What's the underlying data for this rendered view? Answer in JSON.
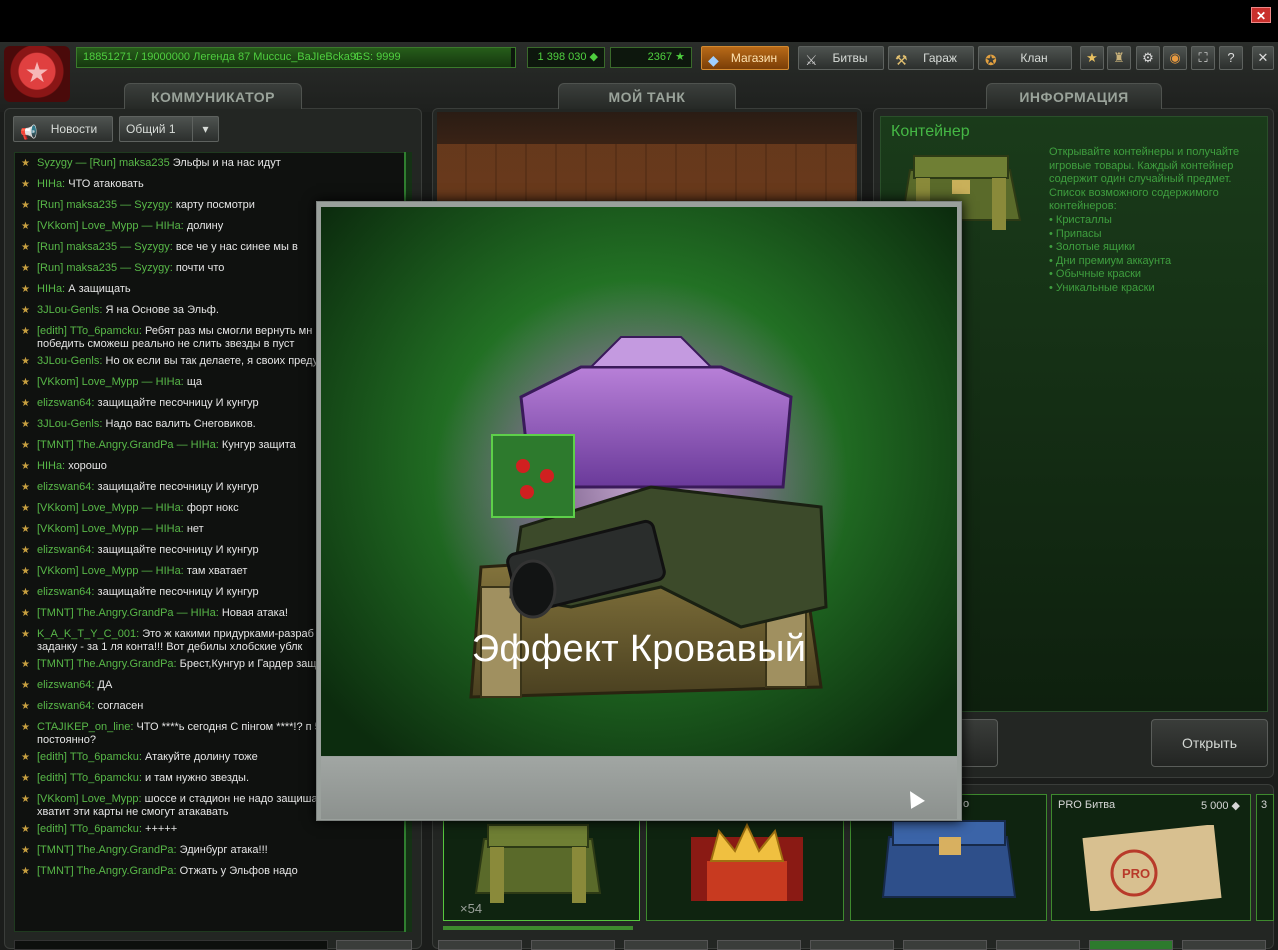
{
  "topbar": {
    "rank_text": "18851271 / 19000000  Легенда 87 Muccuc_BaJIeBcka9I",
    "rank_progress": 0.99,
    "gs": "GS: 9999",
    "crystals": "1 398 030",
    "stars": "2367",
    "shop": "Магазин",
    "battles": "Битвы",
    "garage": "Гараж",
    "clan": "Клан",
    "help": "?"
  },
  "panels": {
    "communicator": "КОММУНИКАТОР",
    "my_tank": "МОЙ ТАНК",
    "information": "ИНФОРМАЦИЯ"
  },
  "chat": {
    "news_button": "Новости",
    "channel": "Общий 1",
    "messages": [
      {
        "sender": "Syzygy",
        "receiver": "[Run] maksa235",
        "text": "Эльфы и на нас идут"
      },
      {
        "sender": "HIHa:",
        "receiver": "",
        "text": "ЧТО атаковать"
      },
      {
        "sender": "[Run] maksa235",
        "receiver": "Syzygy:",
        "text": "карту посмотри"
      },
      {
        "sender": "[VKkom] Love_Mypp",
        "receiver": "HIHa:",
        "text": "долину"
      },
      {
        "sender": "[Run] maksa235",
        "receiver": "Syzygy:",
        "text": "все че у нас синее мы в"
      },
      {
        "sender": "[Run] maksa235",
        "receiver": "Syzygy:",
        "text": "почти что"
      },
      {
        "sender": "HIHa:",
        "receiver": "",
        "text": "А защищать"
      },
      {
        "sender": "3JLou-Genls:",
        "receiver": "",
        "text": "Я на Основе за Эльф."
      },
      {
        "sender": "[edith] TTo_6pamcku:",
        "receiver": "",
        "text": "Ребят раз мы смогли вернуть мн карт,значит и победить сможеш реально не слить звезды в пуст"
      },
      {
        "sender": "3JLou-Genls:",
        "receiver": "",
        "text": "Но ок если вы так делаете, я своих преду"
      },
      {
        "sender": "[VKkom] Love_Mypp",
        "receiver": "HIHa:",
        "text": "ща"
      },
      {
        "sender": "elizswan64:",
        "receiver": "",
        "text": "защищайте песочницу И кунгур"
      },
      {
        "sender": "3JLou-Genls:",
        "receiver": "",
        "text": "Надо вас валить Снеговиков."
      },
      {
        "sender": "[TMNT] The.Angry.GrandPa",
        "receiver": "HIHa:",
        "text": "Кунгур защита"
      },
      {
        "sender": "HIHa:",
        "receiver": "",
        "text": "хорошо"
      },
      {
        "sender": "elizswan64:",
        "receiver": "",
        "text": "защищайте песочницу И кунгур"
      },
      {
        "sender": "[VKkom] Love_Mypp",
        "receiver": "HIHa:",
        "text": "форт нокс"
      },
      {
        "sender": "[VKkom] Love_Mypp",
        "receiver": "HIHa:",
        "text": "нет"
      },
      {
        "sender": "elizswan64:",
        "receiver": "",
        "text": "защищайте песочницу И кунгур"
      },
      {
        "sender": "[VKkom] Love_Mypp",
        "receiver": "HIHa:",
        "text": "там хватает"
      },
      {
        "sender": "elizswan64:",
        "receiver": "",
        "text": "защищайте песочницу И кунгур"
      },
      {
        "sender": "[TMNT] The.Angry.GrandPa",
        "receiver": "HIHa:",
        "text": "Новая атака!"
      },
      {
        "sender": "K_A_K_T_Y_C_001:",
        "receiver": "",
        "text": "Это ж какими придурками-разраб что бы сотворить заданку - за 1 ля конта!!! Вот дебилы хлобские ублк"
      },
      {
        "sender": "[TMNT] The.Angry.GrandPa:",
        "receiver": "",
        "text": "Брест,Кунгур и Гардер защ"
      },
      {
        "sender": "elizswan64:",
        "receiver": "",
        "text": "ДА"
      },
      {
        "sender": "elizswan64:",
        "receiver": "",
        "text": "согласен"
      },
      {
        "sender": "CTAJIKEP_on_line:",
        "receiver": "",
        "text": "ЧТО ****ь сегодня С пінгом ****!? п 500 І ВЫШЕ постоянно?"
      },
      {
        "sender": "[edith] TTo_6pamcku:",
        "receiver": "",
        "text": "Атакуйте долину тоже"
      },
      {
        "sender": "[edith] TTo_6pamcku:",
        "receiver": "",
        "text": "и там нужно звезды."
      },
      {
        "sender": "[VKkom] Love_Mypp:",
        "receiver": "",
        "text": "шоссе и стадион не надо защишать там 100 звёзд хватит эти карты не смогут атакавать"
      },
      {
        "sender": "[edith] TTo_6pamcku:",
        "receiver": "",
        "text": "+++++"
      },
      {
        "sender": "[TMNT] The.Angry.GrandPa:",
        "receiver": "",
        "text": "Эдинбург атака!!!"
      },
      {
        "sender": "[TMNT] The.Angry.GrandPa:",
        "receiver": "",
        "text": "Отжать у Эльфов надо"
      }
    ]
  },
  "info": {
    "title": "Контейнер",
    "description": "Открывайте контейнеры и получайте игровые товары. Каждый контейнер содержит один случайный предмет. Список возможного содержимого контейнеров:",
    "items": [
      "• Кристаллы",
      "• Припасы",
      "• Золотые ящики",
      "• Дни премиум аккаунта",
      "• Обычные краски",
      "• Уникальные краски"
    ],
    "open_button": "Открыть"
  },
  "garage": {
    "slot1_count": "×54",
    "slot4_label": "PRO Битва",
    "slot4_price": "5 000",
    "slot3_label": "о",
    "slot5_label": "3"
  },
  "modal": {
    "prize": "Эффект Кровавый"
  },
  "colors": {
    "accent_green": "#45b845",
    "shop_orange": "#b86a18"
  }
}
